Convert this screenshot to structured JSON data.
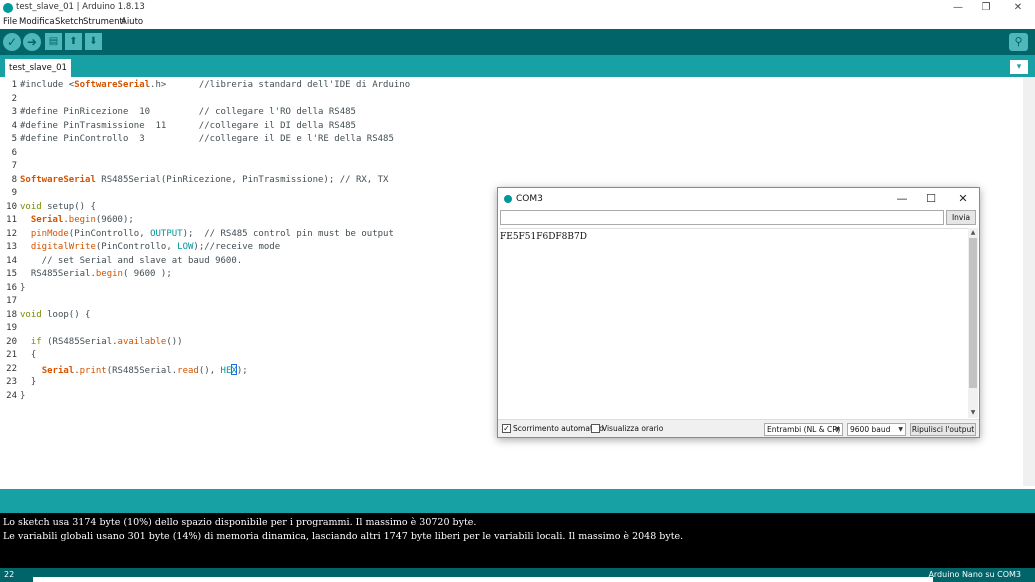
{
  "window": {
    "title": "test_slave_01 | Arduino 1.8.13",
    "minimize": "—",
    "maximize": "❐",
    "close": "✕"
  },
  "menu": [
    "File",
    "Modifica",
    "Sketch",
    "Strumenti",
    "Aiuto"
  ],
  "toolbar": {
    "verify_icon": "check-icon",
    "upload_icon": "arrow-right-icon",
    "new_icon": "file-icon",
    "open_icon": "arrow-up-icon",
    "save_icon": "arrow-down-icon",
    "serial_icon": "magnifier-icon"
  },
  "tabs": [
    {
      "label": "test_slave_01",
      "active": true
    }
  ],
  "editor": {
    "line_numbers": [
      "1",
      "2",
      "3",
      "4",
      "5",
      "6",
      "7",
      "8",
      "9",
      "10",
      "11",
      "12",
      "13",
      "14",
      "15",
      "16",
      "17",
      "18",
      "19",
      "20",
      "21",
      "22",
      "23",
      "24"
    ]
  },
  "console": {
    "lines": [
      "Lo sketch usa 3174 byte (10%) dello spazio disponibile per i programmi. Il massimo è 30720 byte.",
      "Le variabili globali usano 301 byte (14%) di memoria dinamica, lasciando altri 1747 byte liberi per le variabili locali. Il massimo è 2048 byte."
    ]
  },
  "status": {
    "line": "22",
    "board": "Arduino Nano su COM3"
  },
  "serial_monitor": {
    "title": "COM3",
    "input_value": "",
    "send_label": "Invia",
    "output": "FE5F51F6DF8B7D",
    "autoscroll_label": "Scorrimento automatico",
    "autoscroll_checked": true,
    "timestamp_label": "Visualizza orario",
    "timestamp_checked": false,
    "line_ending": "Entrambi (NL & CR)",
    "baud": "9600 baud",
    "clear_label": "Ripulisci l'output"
  },
  "colors": {
    "toolbar": "#006468",
    "tabbar": "#17a1a5",
    "keyword": "#728e00",
    "function": "#d35400",
    "constant": "#00979c"
  }
}
